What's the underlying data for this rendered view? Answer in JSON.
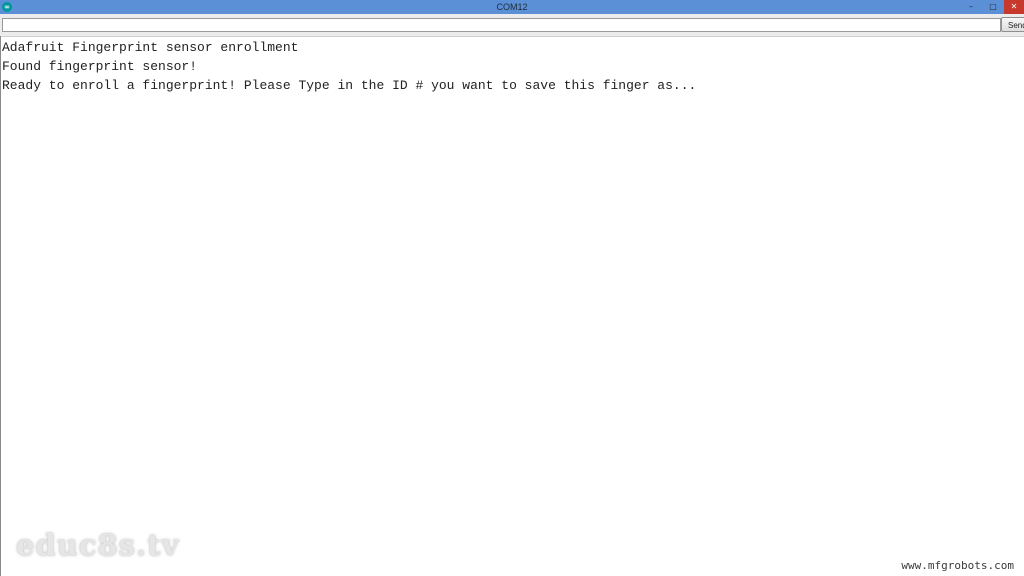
{
  "window": {
    "title": "COM12",
    "app_icon": "arduino-infinity-icon",
    "controls": {
      "minimize": "minimize-icon",
      "maximize": "maximize-icon",
      "close": "close-icon"
    },
    "colors": {
      "titlebar": "#5b8fd6",
      "close_button": "#c7392c"
    }
  },
  "toolbar": {
    "input_value": "",
    "send_label": "Send"
  },
  "serial_output": {
    "lines": [
      "Adafruit Fingerprint sensor enrollment",
      "Found fingerprint sensor!",
      "Ready to enroll a fingerprint! Please Type in the ID # you want to save this finger as..."
    ]
  },
  "watermarks": {
    "left": "educ8s.tv",
    "right": "www.mfgrobots.com"
  }
}
